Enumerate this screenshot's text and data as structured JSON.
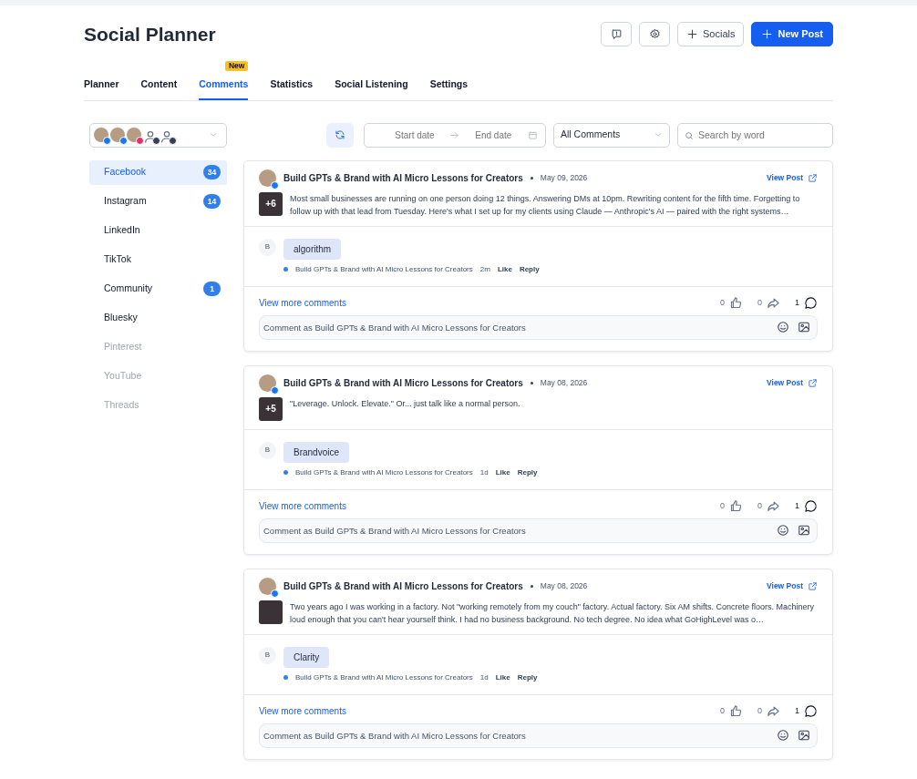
{
  "title": "Social Planner",
  "header_buttons": [
    {
      "kind": "feedback"
    },
    {
      "kind": "settings"
    },
    {
      "kind": "add",
      "label": "Socials"
    },
    {
      "kind": "primary",
      "label": "New Post"
    }
  ],
  "tabs": [
    {
      "label": "Planner",
      "selected": false
    },
    {
      "label": "Content",
      "selected": false
    },
    {
      "label": "Comments",
      "selected": true,
      "badge": "New"
    },
    {
      "label": "Statistics",
      "selected": false
    },
    {
      "label": "Social Listening",
      "selected": false
    },
    {
      "label": "Settings",
      "selected": false
    }
  ],
  "accounts": [
    {
      "kind": "photo",
      "color": "#1877f2"
    },
    {
      "kind": "photo",
      "color": "#1877f2"
    },
    {
      "kind": "photo",
      "color": "#e1306c"
    },
    {
      "kind": "silhouette",
      "color": "#344054"
    },
    {
      "kind": "silhouette",
      "color": "#344054"
    }
  ],
  "filters": {
    "start_placeholder": "Start date",
    "end_placeholder": "End date",
    "comment_filter": "All Comments",
    "search_placeholder": "Search by word"
  },
  "sidebar": [
    {
      "label": "Facebook",
      "count": "34",
      "selected": true,
      "disabled": false
    },
    {
      "label": "Instagram",
      "count": "14",
      "selected": false,
      "disabled": false
    },
    {
      "label": "LinkedIn",
      "selected": false,
      "disabled": false
    },
    {
      "label": "TikTok",
      "selected": false,
      "disabled": false
    },
    {
      "label": "Community",
      "count": "1",
      "selected": false,
      "disabled": false
    },
    {
      "label": "Bluesky",
      "selected": false,
      "disabled": false
    },
    {
      "label": "Pinterest",
      "selected": false,
      "disabled": true
    },
    {
      "label": "YouTube",
      "selected": false,
      "disabled": true
    },
    {
      "label": "Threads",
      "selected": false,
      "disabled": true
    }
  ],
  "posts": [
    {
      "author": "Build GPTs & Brand with AI Micro Lessons for Creators",
      "date": "May 09, 2026",
      "view_link": "View Post",
      "media_count": "+6",
      "text": "Most small businesses are running on one person doing 12 things. Answering DMs at 10pm. Rewriting content for the fifth time. Forgetting to follow up with that lead from Tuesday. Here's what I set up for my clients using Claude — Anthropic's AI — paired with the right systems…",
      "comment": {
        "initial": "B",
        "text": "algorithm",
        "author": "Build GPTs & Brand with AI Micro Lessons for Creators",
        "time": "2m",
        "like": "Like",
        "reply": "Reply"
      },
      "more": "View more comments",
      "likes": "0",
      "shares": "0",
      "comments": "1",
      "input_placeholder": "Comment as Build GPTs & Brand with AI Micro Lessons for Creators"
    },
    {
      "author": "Build GPTs & Brand with AI Micro Lessons for Creators",
      "date": "May 08, 2026",
      "view_link": "View Post",
      "media_count": "+5",
      "text": "\"Leverage. Unlock. Elevate.\" Or... just talk like a normal person.",
      "comment": {
        "initial": "B",
        "text": "Brandvoice",
        "author": "Build GPTs & Brand with AI Micro Lessons for Creators",
        "time": "1d",
        "like": "Like",
        "reply": "Reply"
      },
      "more": "View more comments",
      "likes": "0",
      "shares": "0",
      "comments": "1",
      "input_placeholder": "Comment as Build GPTs & Brand with AI Micro Lessons for Creators"
    },
    {
      "author": "Build GPTs & Brand with AI Micro Lessons for Creators",
      "date": "May 08, 2026",
      "view_link": "View Post",
      "text": "Two years ago I was working in a factory. Not \"working remotely from my couch\" factory. Actual factory. Six AM shifts. Concrete floors. Machinery loud enough that you can't hear yourself think. I had no business background. No tech degree. No idea what GoHighLevel was o…",
      "comment": {
        "initial": "B",
        "text": "Clarity",
        "author": "Build GPTs & Brand with AI Micro Lessons for Creators",
        "time": "1d",
        "like": "Like",
        "reply": "Reply"
      },
      "more": "View more comments",
      "likes": "0",
      "shares": "0",
      "comments": "1",
      "input_placeholder": "Comment as Build GPTs & Brand with AI Micro Lessons for Creators"
    }
  ]
}
